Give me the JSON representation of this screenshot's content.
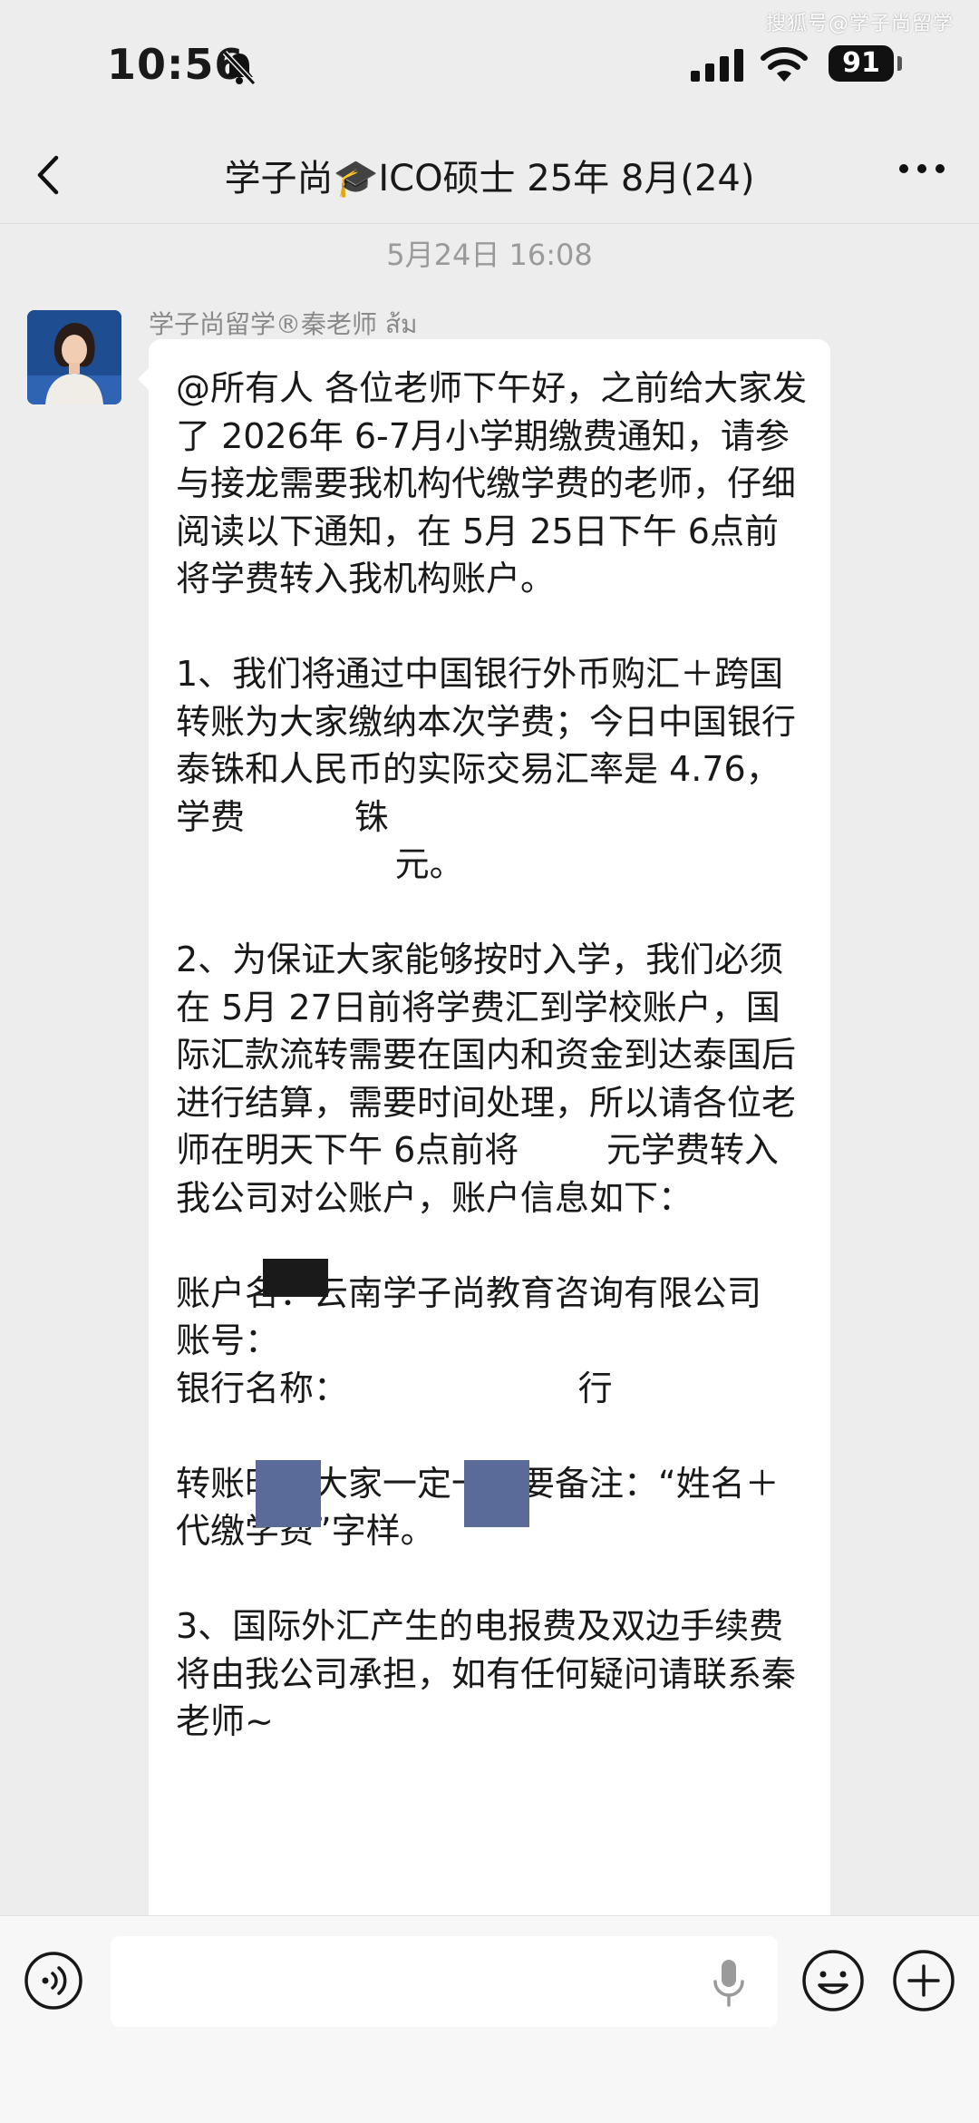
{
  "watermark": "搜狐号@学子尚留学",
  "status_bar": {
    "time": "10:56",
    "battery": "91"
  },
  "header": {
    "title": "学子尚🎓ICO硕士 25年 8月(24)"
  },
  "chat": {
    "timestamp": "5月24日 16:08",
    "sender_name": "学子尚留学®秦老师 ส้ม",
    "message": "@所有人 各位老师下午好，之前给大家发了 2026年 6-7月小学期缴费通知，请参与接龙需要我机构代缴学费的老师，仔细阅读以下通知，在 5月 25日下午 6点前将学费转入我机构账户。\n\n1、我们将通过中国银行外币购汇＋跨国转账为大家缴纳本次学费；今日中国银行泰铢和人民币的实际交易汇率是 4.76，学费          铢\n                    元。\n\n2、为保证大家能够按时入学，我们必须在 5月 27日前将学费汇到学校账户，国际汇款流转需要在国内和资金到达泰国后进行结算，需要时间处理，所以请各位老师在明天下午 6点前将        元学费转入我公司对公账户，账户信息如下：\n\n账户名：云南学子尚教育咨询有限公司\n账号：\n银行名称：                     行\n\n转账时请大家一定一定要备注：“姓名＋代缴学费”字样。\n\n3、国际外汇产生的电报费及双边手续费将由我公司承担，如有任何疑问请联系秦老师~"
  },
  "colors": {
    "background": "#ededed",
    "bubble": "#ffffff",
    "redact_blue": "#5a6b99"
  }
}
